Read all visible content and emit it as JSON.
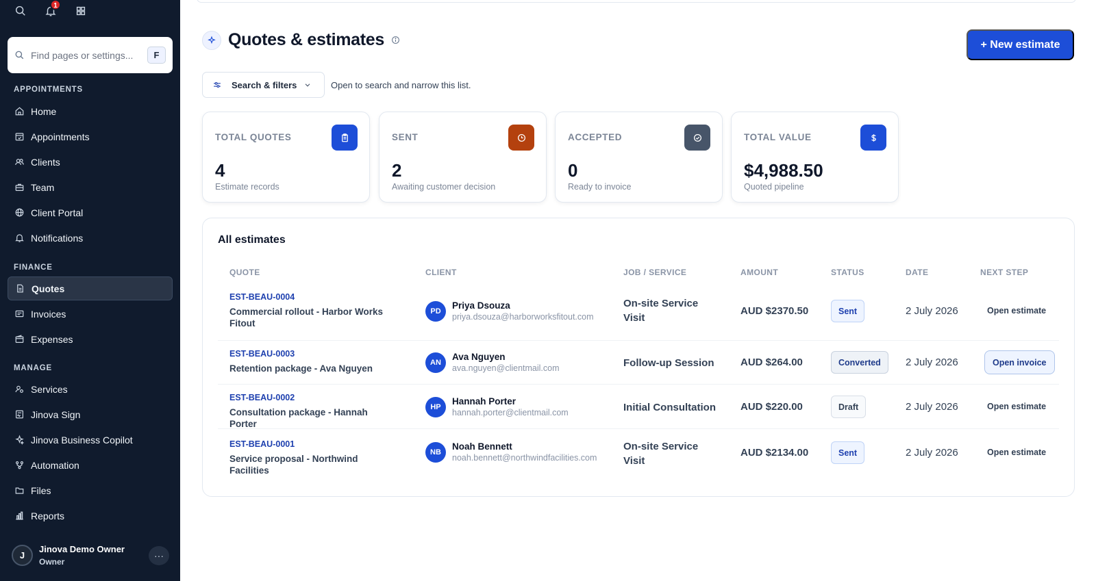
{
  "sidebar": {
    "notification_count": "1",
    "search_placeholder": "Find pages or settings...",
    "search_shortcut": "F",
    "sections": {
      "appointments": "APPOINTMENTS",
      "finance": "FINANCE",
      "manage": "MANAGE"
    },
    "items": {
      "home": "Home",
      "appointments": "Appointments",
      "clients": "Clients",
      "team": "Team",
      "client_portal": "Client Portal",
      "notifications": "Notifications",
      "quotes": "Quotes",
      "invoices": "Invoices",
      "expenses": "Expenses",
      "services": "Services",
      "jinova_sign": "Jinova Sign",
      "copilot": "Jinova Business Copilot",
      "automation": "Automation",
      "files": "Files",
      "reports": "Reports"
    },
    "user": {
      "initial": "J",
      "name": "Jinova Demo Owner",
      "role": "Owner",
      "more": "···"
    }
  },
  "header": {
    "title": "Quotes & estimates",
    "new_button": "+ New estimate",
    "filter_button": "Search & filters",
    "filter_hint": "Open to search and narrow this list."
  },
  "stats": [
    {
      "label": "TOTAL QUOTES",
      "value": "4",
      "sub": "Estimate records",
      "icon": "clipboard-icon",
      "color": "#1d4ed8"
    },
    {
      "label": "SENT",
      "value": "2",
      "sub": "Awaiting customer decision",
      "icon": "clock-icon",
      "color": "#b4410e"
    },
    {
      "label": "ACCEPTED",
      "value": "0",
      "sub": "Ready to invoice",
      "icon": "check-circle-icon",
      "color": "#475569"
    },
    {
      "label": "TOTAL VALUE",
      "value": "$4,988.50",
      "sub": "Quoted pipeline",
      "icon": "dollar-icon",
      "color": "#1d4ed8"
    }
  ],
  "table": {
    "title": "All estimates",
    "columns": {
      "quote": "QUOTE",
      "client": "CLIENT",
      "job": "JOB / SERVICE",
      "amount": "AMOUNT",
      "status": "STATUS",
      "date": "DATE",
      "next_step": "NEXT STEP"
    },
    "rows": [
      {
        "id": "EST-BEAU-0004",
        "name": "Commercial rollout - Harbor Works Fitout",
        "initials": "PD",
        "client": "Priya Dsouza",
        "email": "priya.dsouza@harborworksfitout.com",
        "job": "On-site Service Visit",
        "amount": "AUD $2370.50",
        "status": "Sent",
        "date": "2 July 2026",
        "next_step": "Open estimate"
      },
      {
        "id": "EST-BEAU-0003",
        "name": "Retention package - Ava Nguyen",
        "initials": "AN",
        "client": "Ava Nguyen",
        "email": "ava.nguyen@clientmail.com",
        "job": "Follow-up Session",
        "amount": "AUD $264.00",
        "status": "Converted",
        "date": "2 July 2026",
        "next_step": "Open invoice"
      },
      {
        "id": "EST-BEAU-0002",
        "name": "Consultation package - Hannah Porter",
        "initials": "HP",
        "client": "Hannah Porter",
        "email": "hannah.porter@clientmail.com",
        "job": "Initial Consultation",
        "amount": "AUD $220.00",
        "status": "Draft",
        "date": "2 July 2026",
        "next_step": "Open estimate"
      },
      {
        "id": "EST-BEAU-0001",
        "name": "Service proposal - Northwind Facilities",
        "initials": "NB",
        "client": "Noah Bennett",
        "email": "noah.bennett@northwindfacilities.com",
        "job": "On-site Service Visit",
        "amount": "AUD $2134.00",
        "status": "Sent",
        "date": "2 July 2026",
        "next_step": "Open estimate"
      }
    ]
  }
}
